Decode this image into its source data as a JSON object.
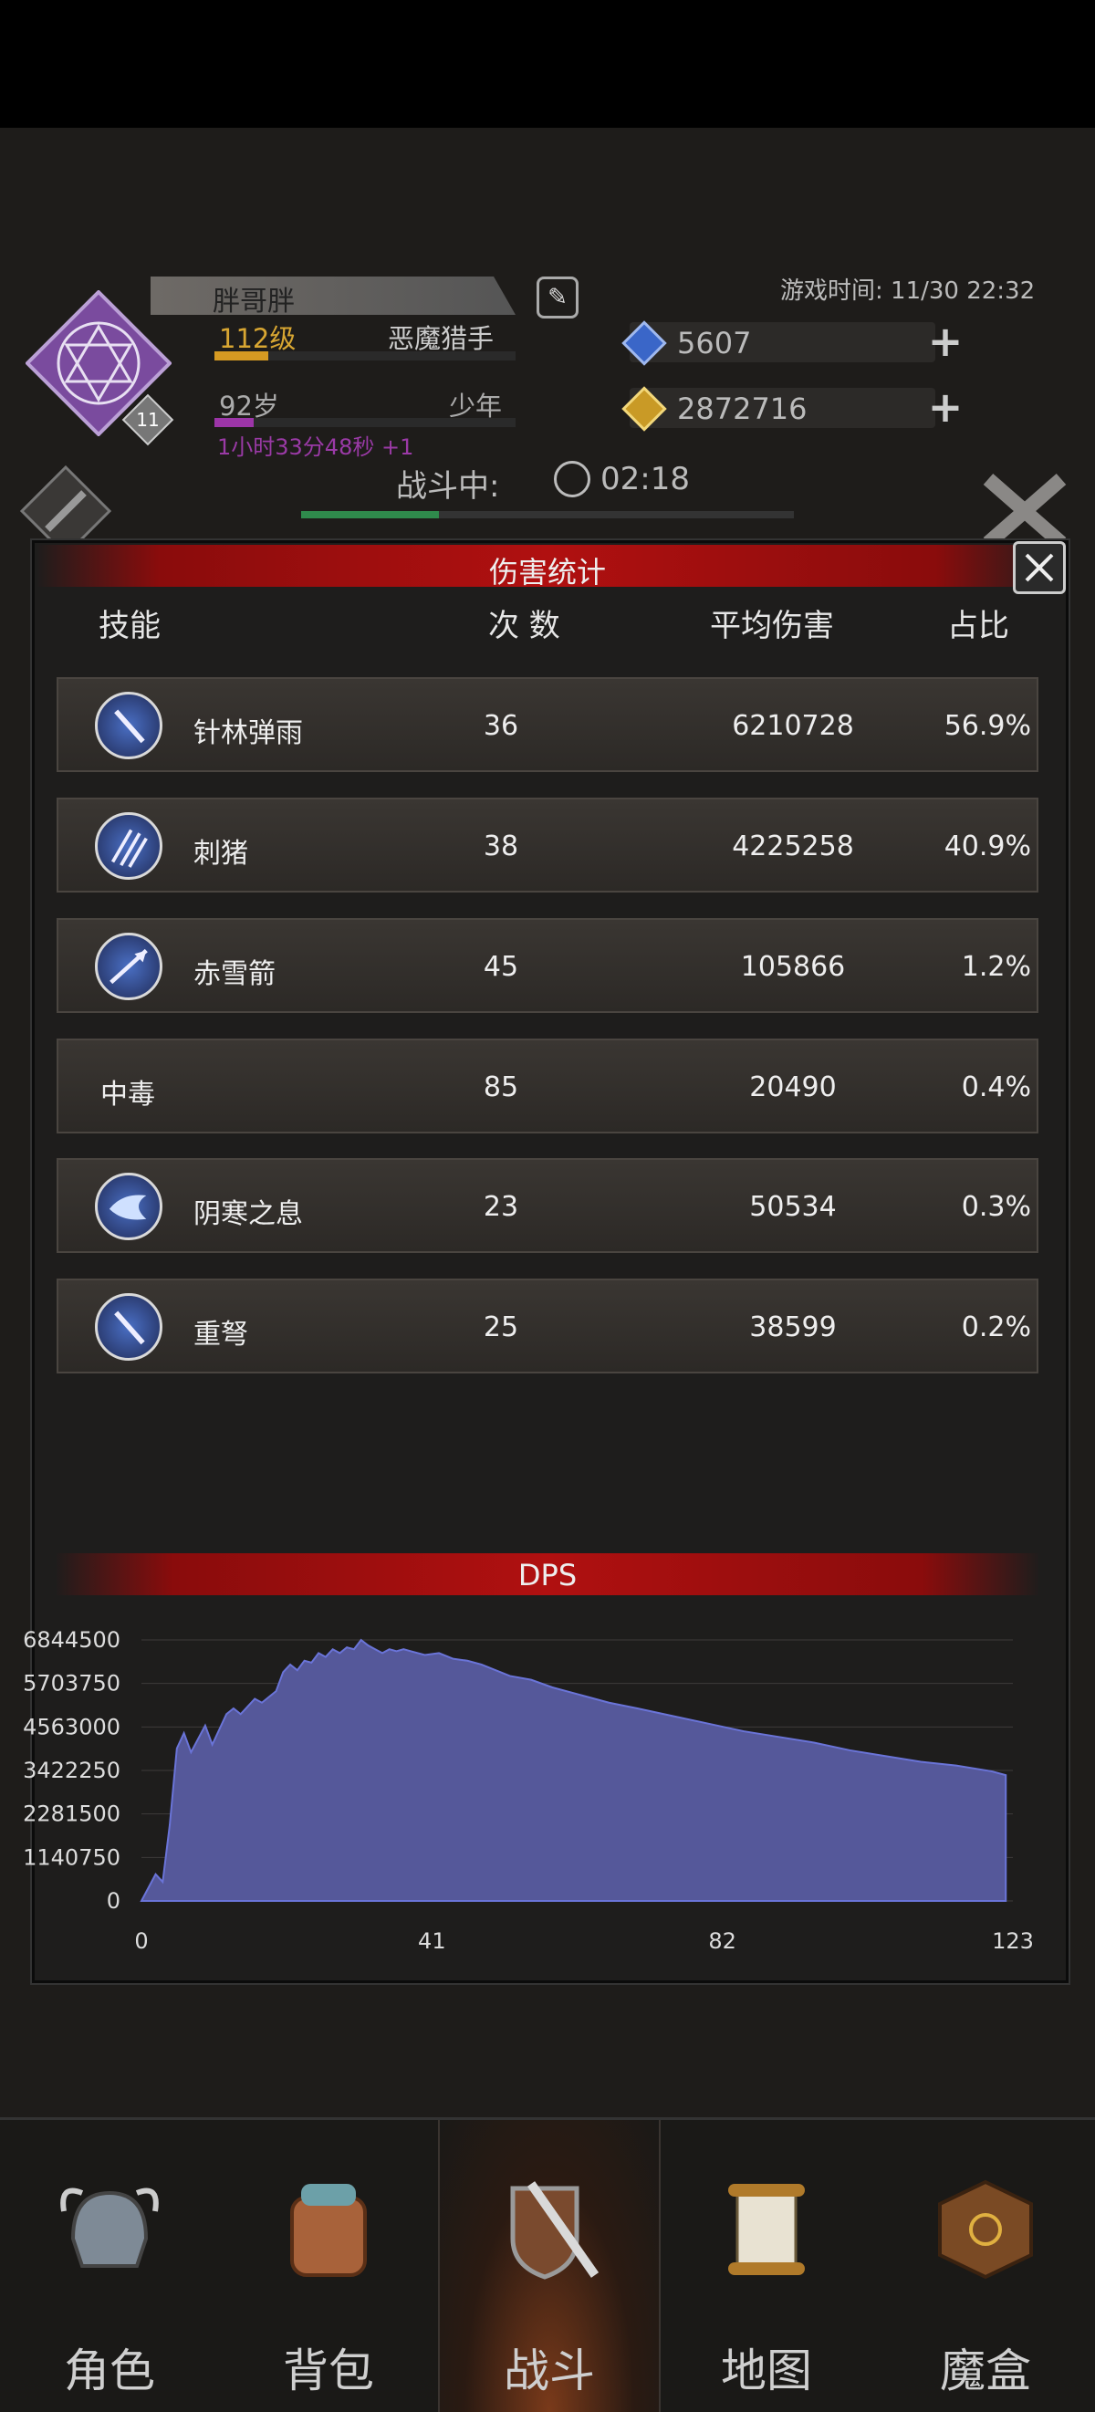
{
  "player": {
    "name": "胖哥胖",
    "level": "112级",
    "role": "恶魔猎手",
    "level_progress": 0.18,
    "age": "92岁",
    "age_stage": "少年",
    "age_progress": 0.13,
    "playtime": "1小时33分48秒 +1",
    "emblem_level": "11"
  },
  "header": {
    "game_time": "游戏时间: 11/30 22:32",
    "gems": "5607",
    "gold": "2872716",
    "battle_label": "战斗中:",
    "battle_time": "02:18",
    "battle_progress": 0.28
  },
  "damage_panel": {
    "title": "伤害统计",
    "columns": [
      "技能",
      "次 数",
      "平均伤害",
      "占比"
    ],
    "rows": [
      {
        "skill": "针林弹雨",
        "count": "36",
        "avg": "6210728",
        "pct": "56.9%",
        "icon": "dagger-rain-icon"
      },
      {
        "skill": "刺猪",
        "count": "38",
        "avg": "4225258",
        "pct": "40.9%",
        "icon": "triple-spike-icon"
      },
      {
        "skill": "赤雪箭",
        "count": "45",
        "avg": "105866",
        "pct": "1.2%",
        "icon": "snow-arrow-icon"
      },
      {
        "skill": "中毒",
        "count": "85",
        "avg": "20490",
        "pct": "0.4%",
        "icon": ""
      },
      {
        "skill": "阴寒之息",
        "count": "23",
        "avg": "50534",
        "pct": "0.3%",
        "icon": "cold-breath-icon"
      },
      {
        "skill": "重弩",
        "count": "25",
        "avg": "38599",
        "pct": "0.2%",
        "icon": "heavy-crossbow-icon"
      }
    ]
  },
  "chart_data": {
    "type": "area",
    "title": "DPS",
    "xlabel": "",
    "ylabel": "",
    "xlim": [
      0,
      123
    ],
    "ylim": [
      0,
      6844500
    ],
    "xticks": [
      "0",
      "41",
      "82",
      "123"
    ],
    "yticks": [
      "0",
      "1140750",
      "2281500",
      "3422250",
      "4563000",
      "5703750",
      "6844500"
    ],
    "grid": true,
    "color": "#55589a",
    "x": [
      0,
      2,
      3,
      4,
      5,
      6,
      7,
      9,
      10,
      12,
      13,
      14,
      16,
      17,
      19,
      20,
      21,
      22,
      23,
      24,
      25,
      26,
      27,
      28,
      29,
      30,
      31,
      32,
      33,
      34,
      35,
      36,
      37,
      38,
      40,
      42,
      44,
      46,
      48,
      50,
      52,
      55,
      58,
      62,
      66,
      70,
      75,
      80,
      85,
      90,
      95,
      100,
      105,
      110,
      115,
      120,
      122
    ],
    "y": [
      0,
      700000,
      500000,
      2000000,
      4000000,
      4400000,
      3900000,
      4600000,
      4100000,
      4900000,
      5050000,
      4900000,
      5300000,
      5200000,
      5500000,
      6000000,
      6200000,
      6050000,
      6300000,
      6250000,
      6500000,
      6400000,
      6600000,
      6500000,
      6650000,
      6600000,
      6844500,
      6700000,
      6600000,
      6500000,
      6600000,
      6550000,
      6600000,
      6550000,
      6450000,
      6500000,
      6350000,
      6300000,
      6200000,
      6050000,
      5900000,
      5800000,
      5600000,
      5400000,
      5200000,
      5050000,
      4850000,
      4650000,
      4450000,
      4300000,
      4150000,
      3950000,
      3800000,
      3650000,
      3550000,
      3400000,
      3300000
    ]
  },
  "nav": [
    {
      "label": "角色",
      "icon": "helmet-icon"
    },
    {
      "label": "背包",
      "icon": "backpack-icon"
    },
    {
      "label": "战斗",
      "icon": "shield-sword-icon"
    },
    {
      "label": "地图",
      "icon": "scroll-map-icon"
    },
    {
      "label": "魔盒",
      "icon": "magic-box-icon"
    }
  ],
  "nav_active_index": 2,
  "colors": {
    "accent_red": "#b01010",
    "level_gold": "#d8a632",
    "age_purple": "#9c35a8",
    "battle_green": "#2f8a4c"
  }
}
